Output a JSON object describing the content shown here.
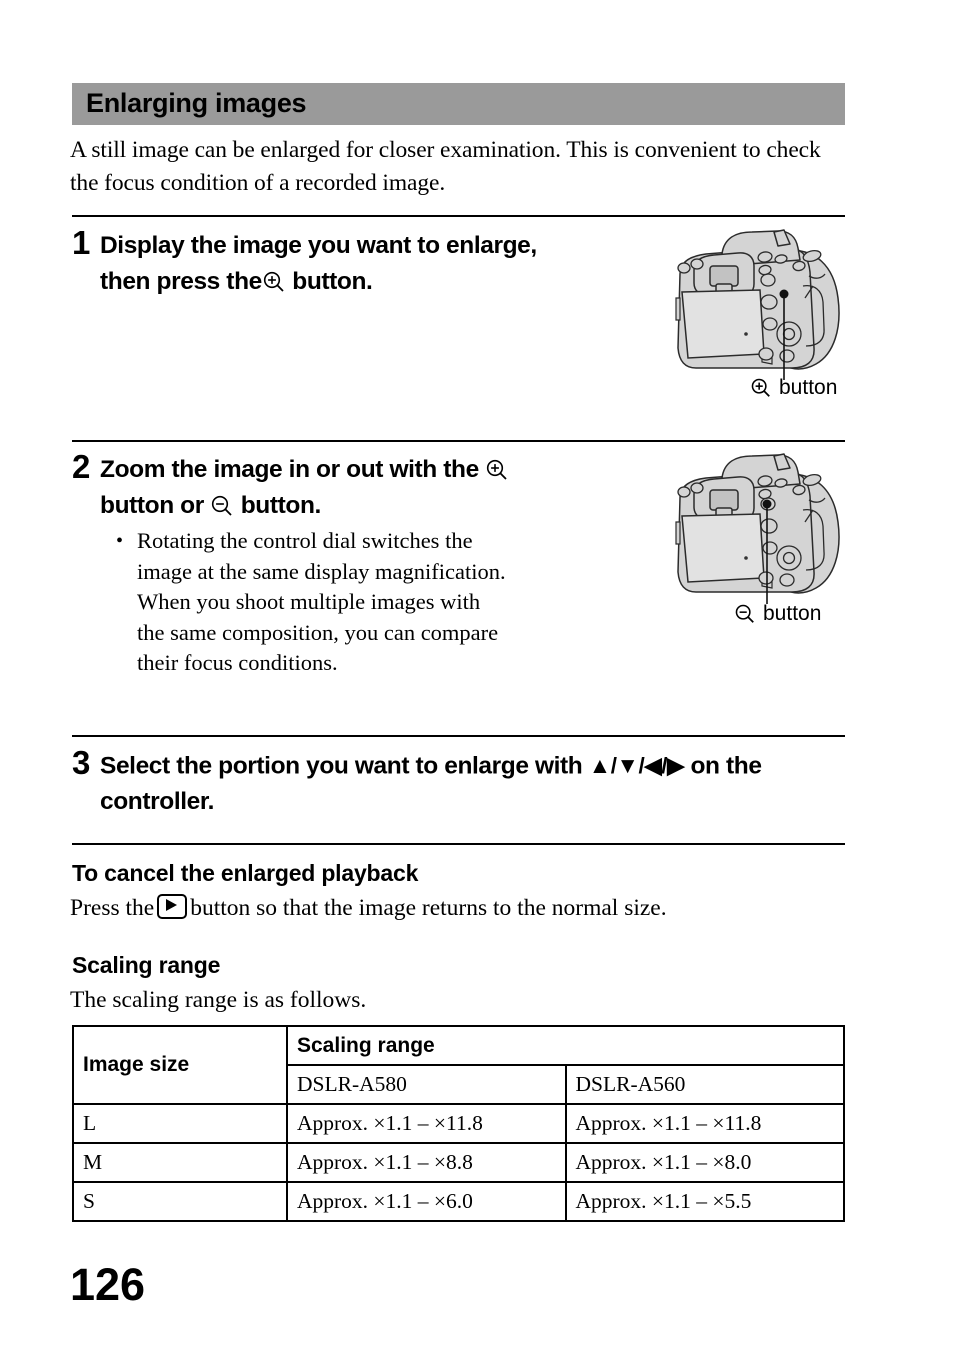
{
  "section": {
    "title": "Enlarging images"
  },
  "intro": "A still image can be enlarged for closer examination. This is convenient to check the focus condition of a recorded image.",
  "steps": [
    {
      "number": "1",
      "head_before": "Display the image you want to enlarge, then press the",
      "head_icon": "magnifier-plus-icon",
      "head_after": "button."
    },
    {
      "number": "2",
      "head_part1": "Zoom the image in or out with the",
      "head_icon1": "magnifier-plus-icon",
      "head_part2": "button or",
      "head_icon2": "magnifier-minus-icon",
      "head_part3": "button.",
      "bullet": "Rotating the control dial switches the image at the same display magnification. When you shoot multiple images with the same composition, you can compare their focus conditions."
    },
    {
      "number": "3",
      "head_part1": "Select the portion you want to enlarge with",
      "controller_keys": "▲/▼/◀/▶",
      "head_part2": "on the controller."
    }
  ],
  "figures": [
    {
      "name": "camera-rear-view-zoom-in",
      "caption_icon": "magnifier-plus-icon",
      "caption": "button"
    },
    {
      "name": "camera-rear-view-zoom-out",
      "caption_icon": "magnifier-minus-icon",
      "caption": "button"
    }
  ],
  "cancel_section": {
    "heading": "To cancel the enlarged playback",
    "text_before": "Press the",
    "icon": "playback-button-icon",
    "text_after": "button so that the image returns to the normal size."
  },
  "scaling_section": {
    "heading": "Scaling range",
    "text": "The scaling range is as follows."
  },
  "table": {
    "header_image_size": "Image size",
    "header_scaling_range": "Scaling range",
    "model_columns": [
      "DSLR-A580",
      "DSLR-A560"
    ],
    "rows": [
      {
        "size": "L",
        "a580": "Approx. ×1.1 – ×11.8",
        "a560": "Approx. ×1.1 – ×11.8"
      },
      {
        "size": "M",
        "a580": "Approx. ×1.1 – ×8.8",
        "a560": "Approx. ×1.1 – ×8.0"
      },
      {
        "size": "S",
        "a580": "Approx. ×1.1 – ×6.0",
        "a560": "Approx. ×1.1 – ×5.5"
      }
    ]
  },
  "page_number": "126",
  "colors": {
    "band": "#9a9a9a",
    "camera_body": "#d4d4d4",
    "camera_outline": "#2b2b2b",
    "text": "#000000"
  }
}
